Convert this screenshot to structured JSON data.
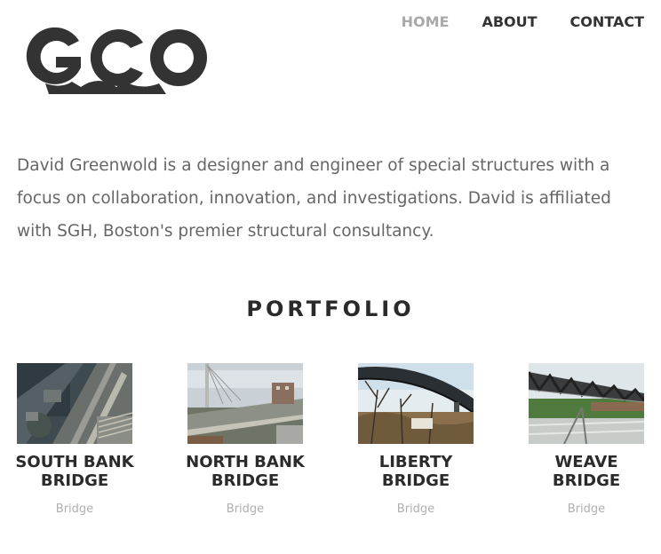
{
  "brand": {
    "logo_text": "GCO"
  },
  "nav": {
    "items": [
      {
        "label": "HOME",
        "active": true
      },
      {
        "label": "ABOUT",
        "active": false
      },
      {
        "label": "CONTACT",
        "active": false
      }
    ],
    "active_color": "#a9a9a9",
    "color": "#333333"
  },
  "intro": {
    "text": "David Greenwold is a designer and engineer of special structures with a focus on collaboration, innovation, and investigations. David is affiliated with SGH, Boston's premier structural consultancy."
  },
  "portfolio": {
    "title": "PORTFOLIO",
    "items": [
      {
        "title_line1": "SOUTH BANK",
        "title_line2": "BRIDGE",
        "category": "Bridge",
        "image": "aerial-photo"
      },
      {
        "title_line1": "NORTH BANK",
        "title_line2": "BRIDGE",
        "category": "Bridge",
        "image": "bridge-photo"
      },
      {
        "title_line1": "LIBERTY",
        "title_line2": "BRIDGE",
        "category": "Bridge",
        "image": "bridge-photo"
      },
      {
        "title_line1": "WEAVE",
        "title_line2": "BRIDGE",
        "category": "Bridge",
        "image": "bridge-photo"
      }
    ]
  }
}
